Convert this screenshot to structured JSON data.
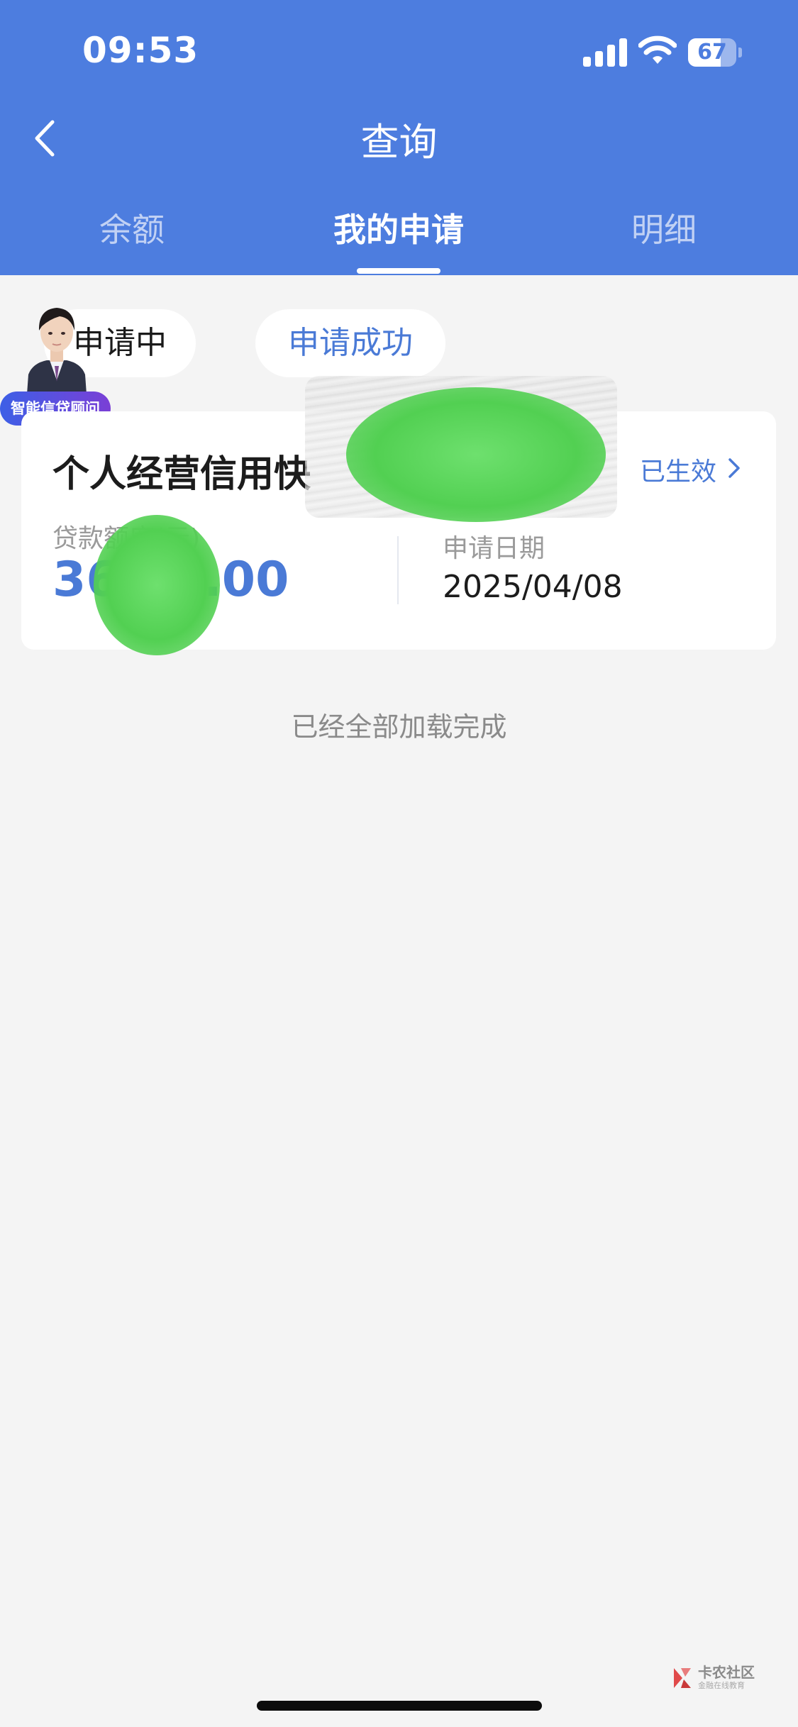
{
  "status_bar": {
    "time": "09:53",
    "battery_level": "67",
    "battery_fraction": 0.67
  },
  "nav": {
    "title": "查询",
    "back_icon": "chevron-left-icon"
  },
  "tabs": [
    {
      "label": "余额",
      "active": false
    },
    {
      "label": "我的申请",
      "active": true
    },
    {
      "label": "明细",
      "active": false
    }
  ],
  "filters": {
    "pending_label": "申请中",
    "success_label": "申请成功",
    "selected": "申请成功"
  },
  "advisor": {
    "badge_label": "智能信贷顾问"
  },
  "application_card": {
    "product_name": "个人经营信用快",
    "status": "已生效",
    "amount_label": "贷款额度(元)",
    "amount_value": "36    00.00",
    "date_label": "申请日期",
    "date_value": "2025/04/08"
  },
  "list_footer": "已经全部加载完成",
  "watermark": {
    "title": "卡农社区",
    "subtitle": "金融在线教育"
  },
  "colors": {
    "header_bg": "#4d7ddf",
    "accent": "#4a7ad6",
    "page_bg": "#f4f4f4",
    "redaction": "#52d052"
  }
}
